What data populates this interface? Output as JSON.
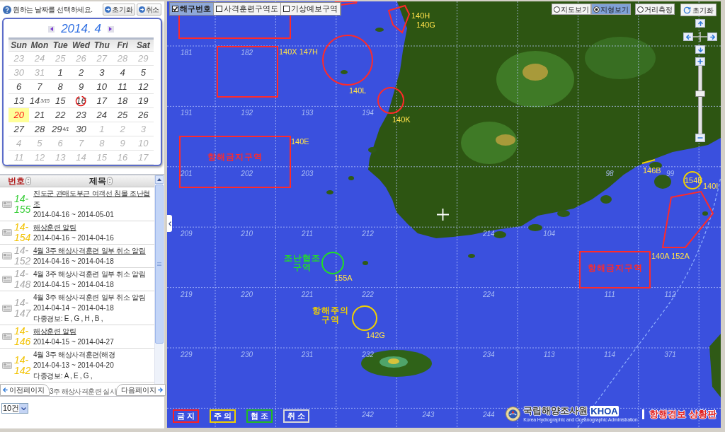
{
  "date_picker": {
    "prompt": "원하는 날짜를 선택하세요.",
    "reset_button": "초기화",
    "cancel_button": "취소",
    "month_label": "2014. 4",
    "weekdays": [
      "Sun",
      "Mon",
      "Tue",
      "Wed",
      "Thu",
      "Fri",
      "Sat"
    ],
    "weeks": [
      [
        {
          "day": "23",
          "muted": true,
          "selected": false,
          "marked": false
        },
        {
          "day": "24",
          "muted": true,
          "selected": false,
          "marked": false
        },
        {
          "day": "25",
          "muted": true,
          "selected": false,
          "marked": false
        },
        {
          "day": "26",
          "muted": true,
          "selected": false,
          "marked": false
        },
        {
          "day": "27",
          "muted": true,
          "selected": false,
          "marked": false
        },
        {
          "day": "28",
          "muted": true,
          "selected": false,
          "marked": false
        },
        {
          "day": "29",
          "muted": true,
          "selected": false,
          "marked": false
        }
      ],
      [
        {
          "day": "30",
          "muted": true,
          "selected": false,
          "marked": false
        },
        {
          "day": "31",
          "muted": true,
          "selected": false,
          "marked": false
        },
        {
          "day": "1",
          "muted": false,
          "selected": false,
          "marked": false
        },
        {
          "day": "2",
          "muted": false,
          "selected": false,
          "marked": false
        },
        {
          "day": "3",
          "muted": false,
          "selected": false,
          "marked": false
        },
        {
          "day": "4",
          "muted": false,
          "selected": false,
          "marked": false
        },
        {
          "day": "5",
          "muted": false,
          "selected": false,
          "marked": false
        }
      ],
      [
        {
          "day": "6",
          "muted": false,
          "selected": false,
          "marked": false
        },
        {
          "day": "7",
          "muted": false,
          "selected": false,
          "marked": false
        },
        {
          "day": "8",
          "muted": false,
          "selected": false,
          "marked": false
        },
        {
          "day": "9",
          "muted": false,
          "selected": false,
          "marked": false
        },
        {
          "day": "10",
          "muted": false,
          "selected": false,
          "marked": false
        },
        {
          "day": "11",
          "muted": false,
          "selected": false,
          "marked": false
        },
        {
          "day": "12",
          "muted": false,
          "selected": false,
          "marked": false
        }
      ],
      [
        {
          "day": "13",
          "muted": false,
          "selected": false,
          "marked": false
        },
        {
          "day": "14",
          "note": "3/15",
          "muted": false,
          "selected": false,
          "marked": false
        },
        {
          "day": "15",
          "muted": false,
          "selected": false,
          "marked": false
        },
        {
          "day": "16",
          "muted": false,
          "selected": false,
          "marked": true
        },
        {
          "day": "17",
          "muted": false,
          "selected": false,
          "marked": false
        },
        {
          "day": "18",
          "muted": false,
          "selected": false,
          "marked": false
        },
        {
          "day": "19",
          "muted": false,
          "selected": false,
          "marked": false
        }
      ],
      [
        {
          "day": "20",
          "muted": false,
          "selected": true,
          "marked": false
        },
        {
          "day": "21",
          "muted": false,
          "selected": false,
          "marked": false
        },
        {
          "day": "22",
          "muted": false,
          "selected": false,
          "marked": false
        },
        {
          "day": "23",
          "muted": false,
          "selected": false,
          "marked": false
        },
        {
          "day": "24",
          "muted": false,
          "selected": false,
          "marked": false
        },
        {
          "day": "25",
          "muted": false,
          "selected": false,
          "marked": false
        },
        {
          "day": "26",
          "muted": false,
          "selected": false,
          "marked": false
        }
      ],
      [
        {
          "day": "27",
          "muted": false,
          "selected": false,
          "marked": false
        },
        {
          "day": "28",
          "muted": false,
          "selected": false,
          "marked": false
        },
        {
          "day": "29",
          "note": "4/1",
          "muted": false,
          "selected": false,
          "marked": false
        },
        {
          "day": "30",
          "muted": false,
          "selected": false,
          "marked": false
        },
        {
          "day": "1",
          "muted": true,
          "selected": false,
          "marked": false
        },
        {
          "day": "2",
          "muted": true,
          "selected": false,
          "marked": false
        },
        {
          "day": "3",
          "muted": true,
          "selected": false,
          "marked": false
        }
      ],
      [
        {
          "day": "4",
          "muted": true,
          "selected": false,
          "marked": false
        },
        {
          "day": "5",
          "muted": true,
          "selected": false,
          "marked": false
        },
        {
          "day": "6",
          "muted": true,
          "selected": false,
          "marked": false
        },
        {
          "day": "7",
          "muted": true,
          "selected": false,
          "marked": false
        },
        {
          "day": "8",
          "muted": true,
          "selected": false,
          "marked": false
        },
        {
          "day": "9",
          "muted": true,
          "selected": false,
          "marked": false
        },
        {
          "day": "10",
          "muted": true,
          "selected": false,
          "marked": false
        }
      ],
      [
        {
          "day": "11",
          "muted": true,
          "selected": false,
          "marked": false
        },
        {
          "day": "12",
          "muted": true,
          "selected": false,
          "marked": false
        },
        {
          "day": "13",
          "muted": true,
          "selected": false,
          "marked": false
        },
        {
          "day": "14",
          "muted": true,
          "selected": false,
          "marked": false
        },
        {
          "day": "15",
          "muted": true,
          "selected": false,
          "marked": false
        },
        {
          "day": "16",
          "muted": true,
          "selected": false,
          "marked": false
        },
        {
          "day": "17",
          "muted": true,
          "selected": false,
          "marked": false
        }
      ]
    ]
  },
  "warning_list": {
    "columns": [
      {
        "label": "번호",
        "selected": true
      },
      {
        "label": "제목",
        "selected": false
      }
    ],
    "items": [
      {
        "number": [
          "14-",
          "155"
        ],
        "color": "#33cc33",
        "title": "진도군 관매도부근 여객선 침몰 조난협조",
        "linked": true,
        "period": "2014-04-16 ~ 2014-05-01"
      },
      {
        "number": [
          "14-",
          "154"
        ],
        "color": "#f2c200",
        "title": "해상훈련 알림",
        "linked": true,
        "period": "2014-04-16 ~ 2014-04-16"
      },
      {
        "number": [
          "14-",
          "152"
        ],
        "color": "#a8a8a8",
        "title": "4월 3주 해상사격훈련 일부 취소 알림",
        "linked": true,
        "period": "2014-04-16 ~ 2014-04-18"
      },
      {
        "number": [
          "14-",
          "148"
        ],
        "color": "#a8a8a8",
        "title": "4월 3주 해상사격훈련 일부 취소 알림",
        "linked": false,
        "period": "2014-04-15 ~ 2014-04-18"
      },
      {
        "number": [
          "14-",
          "147"
        ],
        "color": "#a8a8a8",
        "title": "4월 3주 해상사격훈련 일부 취소 알림",
        "linked": false,
        "period": "2014-04-14 ~ 2014-04-18",
        "multi_alert": "다중경보: E , G , H , B ,"
      },
      {
        "number": [
          "14-",
          "146"
        ],
        "color": "#f2c200",
        "title": "해상훈련 알림",
        "linked": true,
        "period": "2014-04-15 ~ 2014-04-27"
      },
      {
        "number": [
          "14-",
          "142"
        ],
        "color": "#f2c200",
        "title": "4월 3주 해상사격훈련(해경",
        "linked": false,
        "period": "2014-04-13 ~ 2014-04-20",
        "multi_alert": "다중경보: A , E , G ,"
      }
    ],
    "cut_off_title": "3주 해상사격훈련 실시",
    "prev_page": "이전페이지",
    "next_page": "다음페이지",
    "page_size": "10건"
  },
  "map": {
    "layers": [
      {
        "label": "해구번호",
        "checked": true
      },
      {
        "label": "사격훈련구역도",
        "checked": false
      },
      {
        "label": "기상예보구역",
        "checked": false
      }
    ],
    "view_modes": [
      {
        "label": "지도보기",
        "selected": false
      },
      {
        "label": "지형보기",
        "selected": true
      },
      {
        "label": "거리측정",
        "selected": false
      }
    ],
    "reset_button": "초기화",
    "zoom": {
      "level": 0.6
    },
    "grid_numbers": [
      "181",
      "182",
      "191",
      "192",
      "193",
      "194",
      "201",
      "202",
      "203",
      "98",
      "99",
      "209",
      "210",
      "211",
      "212",
      "214",
      "104",
      "219",
      "220",
      "221",
      "222",
      "224",
      "111",
      "112",
      "229",
      "230",
      "231",
      "232",
      "234",
      "113",
      "114",
      "371",
      "242",
      "243",
      "244"
    ],
    "areas": [
      {
        "kind": "rect",
        "color": "#ff2a2a"
      },
      {
        "kind": "rect",
        "color": "#ff2a2a",
        "codes": [
          "140X 147H"
        ]
      },
      {
        "kind": "polygon",
        "color": "#ff2a2a"
      },
      {
        "kind": "polygon",
        "color": "#ff2a2a",
        "codes": [
          "140H",
          "140G"
        ]
      },
      {
        "kind": "circle",
        "color": "#ff2a2a",
        "codes": [
          "140L"
        ]
      },
      {
        "kind": "circle",
        "color": "#ff2a2a",
        "codes": [
          "140K"
        ]
      },
      {
        "kind": "rect",
        "color": "#ff2a2a",
        "title": "항해금지구역",
        "codes": [
          "140E"
        ]
      },
      {
        "kind": "circle",
        "color": "#22e022",
        "title": "조난협조 구역",
        "codes": [
          "155A"
        ]
      },
      {
        "kind": "circle",
        "color": "#f0d000",
        "title": "항해주의 구역",
        "codes": [
          "142G"
        ]
      },
      {
        "kind": "rect",
        "color": "#ff2a2a",
        "title": "항해금지구역"
      },
      {
        "kind": "polygon",
        "color": "#ff2a2a",
        "codes": [
          "140A 152A",
          "140I"
        ]
      },
      {
        "kind": "circle",
        "color": "#f0d000",
        "codes": [
          "154B"
        ]
      },
      {
        "kind": "line",
        "color": "#f0d000",
        "codes": [
          "146B"
        ]
      }
    ],
    "legend": [
      {
        "label": "금 지",
        "color": "#ff2020"
      },
      {
        "label": "주 의",
        "color": "#f0d000"
      },
      {
        "label": "협 조",
        "color": "#22bb22"
      },
      {
        "label": "취 소",
        "color": "#d8d8d8"
      }
    ],
    "logo": {
      "org_name": "국립해양조사원",
      "abbr": "KHOA",
      "english_name": "Korea Hydrographic and Oceanographic Administration",
      "board_title": "항행경보 상황판"
    }
  }
}
